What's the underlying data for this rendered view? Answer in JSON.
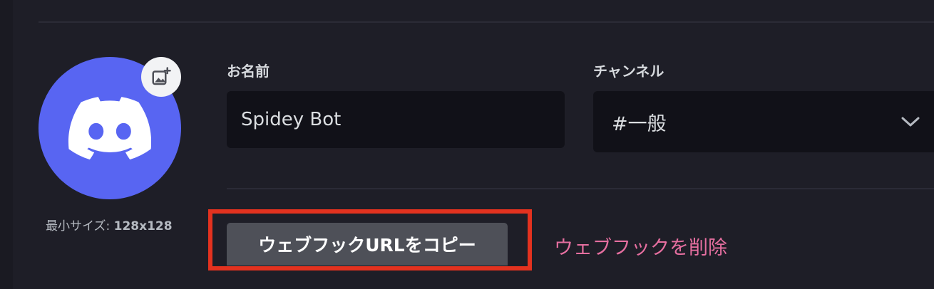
{
  "avatar": {
    "icon": "discord-logo-icon",
    "upload_icon": "image-add-icon",
    "min_size_label": "最小サイズ:",
    "min_size_value": "128x128",
    "color": "#5865f2"
  },
  "name_field": {
    "label": "お名前",
    "value": "Spidey Bot"
  },
  "channel_field": {
    "label": "チャンネル",
    "value": "#一般",
    "icon": "chevron-down-icon"
  },
  "actions": {
    "copy_url_label": "ウェブフックURLをコピー",
    "delete_label": "ウェブフックを削除",
    "delete_color": "#e66fa0",
    "highlight_color": "#e3321f"
  }
}
